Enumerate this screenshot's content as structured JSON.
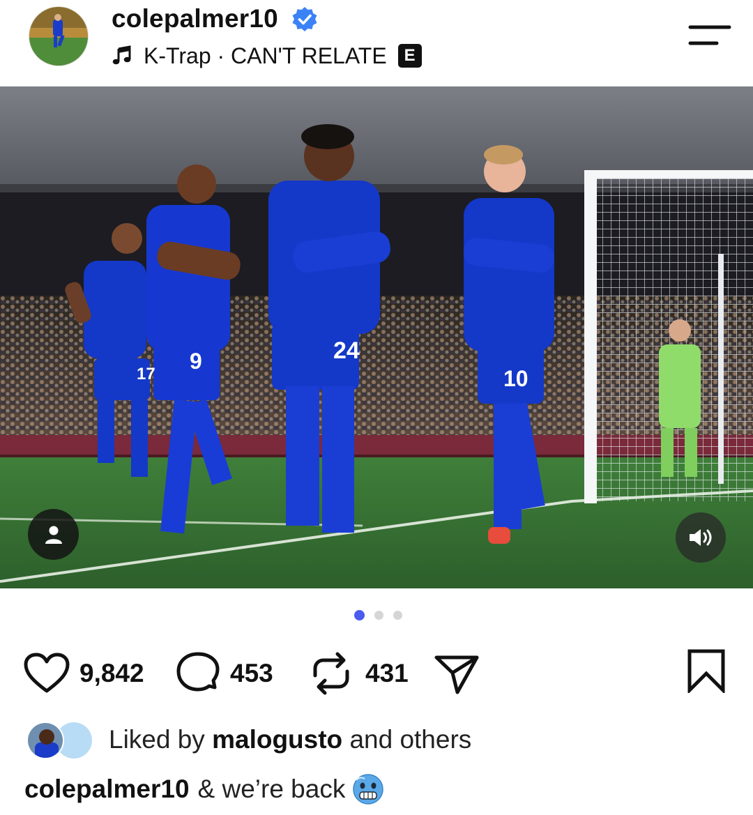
{
  "header": {
    "username": "colepalmer10",
    "verified": true,
    "music": {
      "artist": "K-Trap",
      "separator": " · ",
      "track": "CAN'T RELATE",
      "explicit_badge": "E"
    },
    "menu_icon": "menu-lines-icon"
  },
  "media": {
    "jersey_numbers": [
      "17",
      "9",
      "24",
      "10"
    ],
    "tag_icon": "person-icon",
    "sound_icon": "speaker-on-icon"
  },
  "carousel": {
    "count": 3,
    "active_index": 0
  },
  "actions": {
    "likes_count": "9,842",
    "comments_count": "453",
    "reposts_count": "431",
    "like_icon": "heart-icon",
    "comment_icon": "comment-bubble-icon",
    "repost_icon": "repost-icon",
    "share_icon": "paper-plane-icon",
    "save_icon": "bookmark-icon"
  },
  "likes": {
    "prefix": "Liked by",
    "user": "malogusto",
    "suffix": "and others"
  },
  "caption": {
    "username": "colepalmer10",
    "text": "& we’re back",
    "emoji_name": "cold-face-emoji"
  },
  "colors": {
    "accent": "#4a5bf0",
    "verified": "#3b82f6",
    "kit_blue": "#1438c8",
    "pitch_green": "#3c7a3a"
  }
}
